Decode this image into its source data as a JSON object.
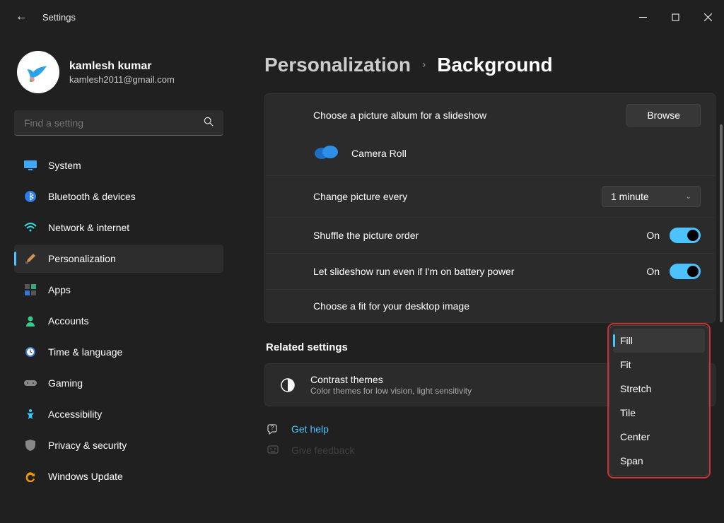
{
  "app": {
    "title": "Settings"
  },
  "profile": {
    "name": "kamlesh kumar",
    "email": "kamlesh2011@gmail.com"
  },
  "search": {
    "placeholder": "Find a setting"
  },
  "sidebar": {
    "items": [
      {
        "label": "System"
      },
      {
        "label": "Bluetooth & devices"
      },
      {
        "label": "Network & internet"
      },
      {
        "label": "Personalization"
      },
      {
        "label": "Apps"
      },
      {
        "label": "Accounts"
      },
      {
        "label": "Time & language"
      },
      {
        "label": "Gaming"
      },
      {
        "label": "Accessibility"
      },
      {
        "label": "Privacy & security"
      },
      {
        "label": "Windows Update"
      }
    ]
  },
  "breadcrumb": {
    "parent": "Personalization",
    "current": "Background"
  },
  "main": {
    "choose_album_label": "Choose a picture album for a slideshow",
    "browse_label": "Browse",
    "camera_roll": "Camera Roll",
    "change_every_label": "Change picture every",
    "change_every_value": "1 minute",
    "shuffle_label": "Shuffle the picture order",
    "shuffle_state": "On",
    "battery_label": "Let slideshow run even if I'm on battery power",
    "battery_state": "On",
    "fit_label": "Choose a fit for your desktop image"
  },
  "related": {
    "heading": "Related settings",
    "contrast_title": "Contrast themes",
    "contrast_sub": "Color themes for low vision, light sensitivity"
  },
  "help": {
    "get_help": "Get help",
    "feedback": "Give feedback"
  },
  "fit_menu": {
    "options": [
      "Fill",
      "Fit",
      "Stretch",
      "Tile",
      "Center",
      "Span"
    ]
  }
}
